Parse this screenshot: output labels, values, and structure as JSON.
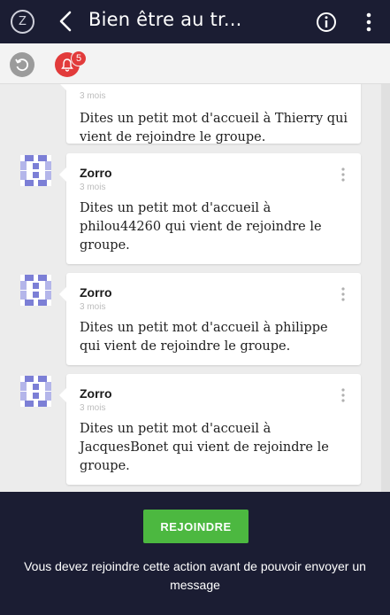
{
  "header": {
    "title": "Bien être au tr...",
    "logo_glyph": "Z"
  },
  "subbar": {
    "notification_count": "5"
  },
  "messages": [
    {
      "author": "",
      "time": "3 mois",
      "text": "Dites un petit mot d'accueil à Thierry qui vient de rejoindre le groupe."
    },
    {
      "author": "Zorro",
      "time": "3 mois",
      "text": "Dites un petit mot d'accueil à philou44260 qui vient de rejoindre le groupe."
    },
    {
      "author": "Zorro",
      "time": "3 mois",
      "text": "Dites un petit mot d'accueil à philippe qui vient de rejoindre le groupe."
    },
    {
      "author": "Zorro",
      "time": "3 mois",
      "text": "Dites un petit mot d'accueil à JacquesBonet qui vient de rejoindre le groupe."
    }
  ],
  "footer": {
    "join_label": "REJOINDRE",
    "notice": "Vous devez rejoindre cette action avant de pouvoir envoyer un message"
  },
  "colors": {
    "topbar": "#1b1d33",
    "join_button": "#4cb840",
    "badge": "#e23b3b",
    "avatar": "#7c7fd6"
  }
}
